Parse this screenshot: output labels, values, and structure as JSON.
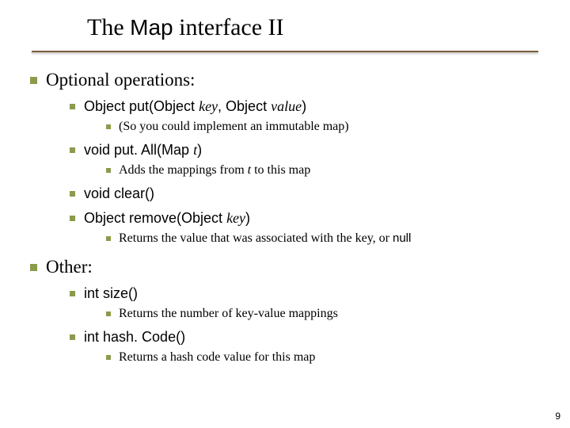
{
  "title_pre": "The ",
  "title_mono": "Map",
  "title_post": " interface II",
  "sections": [
    {
      "label": "Optional operations:",
      "items": [
        {
          "sig_pre": "Object put(Object ",
          "sig_it1": "key",
          "sig_mid": ", Object ",
          "sig_it2": "value",
          "sig_post": ")",
          "notes": [
            {
              "text": "(So you could implement an immutable map)"
            }
          ]
        },
        {
          "sig_pre": "void put. All(Map ",
          "sig_it1": "t",
          "sig_mid": "",
          "sig_it2": "",
          "sig_post": ")",
          "notes": [
            {
              "pre": "Adds the mappings from ",
              "it": "t",
              "post": " to this map"
            }
          ]
        },
        {
          "sig_pre": "void clear()",
          "sig_it1": "",
          "sig_mid": "",
          "sig_it2": "",
          "sig_post": "",
          "notes": []
        },
        {
          "sig_pre": "Object remove(Object ",
          "sig_it1": "key",
          "sig_mid": "",
          "sig_it2": "",
          "sig_post": ")",
          "notes": [
            {
              "pre": "Returns the value that was associated with the key, or ",
              "code": "null"
            }
          ]
        }
      ]
    },
    {
      "label": "Other:",
      "items": [
        {
          "sig_pre": "int size()",
          "sig_it1": "",
          "sig_mid": "",
          "sig_it2": "",
          "sig_post": "",
          "notes": [
            {
              "text": "Returns the number of key-value mappings"
            }
          ]
        },
        {
          "sig_pre": "int hash. Code()",
          "sig_it1": "",
          "sig_mid": "",
          "sig_it2": "",
          "sig_post": "",
          "notes": [
            {
              "text": "Returns a hash code value for this map"
            }
          ]
        }
      ]
    }
  ],
  "page_number": "9"
}
